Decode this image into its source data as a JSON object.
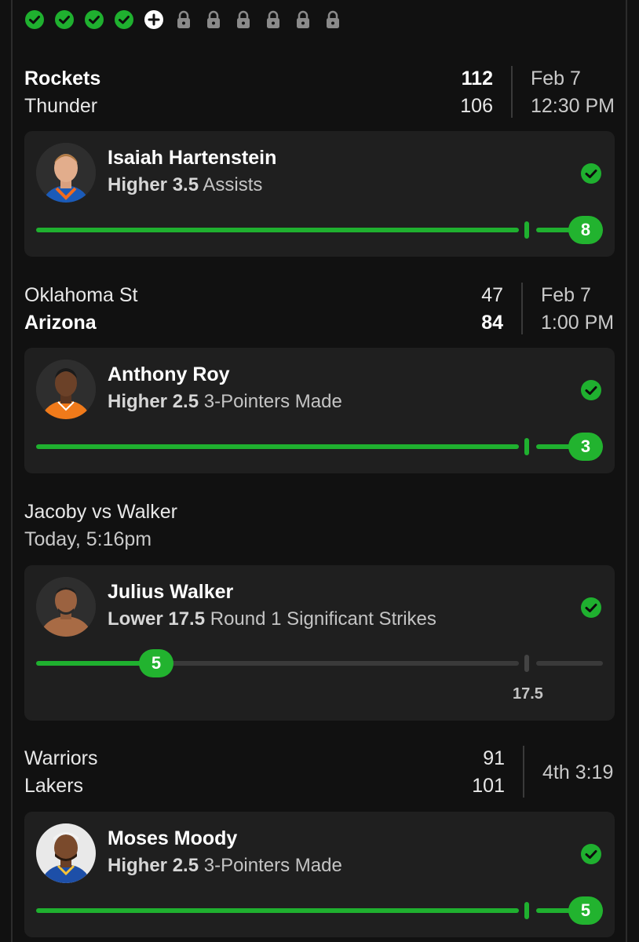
{
  "progress": {
    "pips": [
      "check-icon",
      "check-icon",
      "check-icon",
      "check-icon",
      "plus-icon",
      "lock-icon",
      "lock-icon",
      "lock-icon",
      "lock-icon",
      "lock-icon",
      "lock-icon"
    ]
  },
  "colors": {
    "accent": "#1fb02f",
    "background": "#111111",
    "card": "#1f1f1f",
    "track": "#3a3a3a"
  },
  "games": [
    {
      "teams": [
        {
          "name": "Rockets",
          "score": "112",
          "winner": true
        },
        {
          "name": "Thunder",
          "score": "106",
          "winner": false
        }
      ],
      "date": "Feb 7",
      "time": "12:30 PM",
      "pick": {
        "player": "Isaiah Hartenstein",
        "direction": "Higher",
        "line": "3.5",
        "stat": "Assists",
        "result": "8",
        "result_fraction": 1.0,
        "status_icon": "check-circle-icon"
      }
    },
    {
      "teams": [
        {
          "name": "Oklahoma St",
          "score": "47",
          "winner": false
        },
        {
          "name": "Arizona",
          "score": "84",
          "winner": true
        }
      ],
      "date": "Feb 7",
      "time": "1:00 PM",
      "pick": {
        "player": "Anthony Roy",
        "direction": "Higher",
        "line": "2.5",
        "stat": "3-Pointers Made",
        "result": "3",
        "result_fraction": 1.0,
        "status_icon": "check-circle-icon"
      }
    },
    {
      "title": "Jacoby vs Walker",
      "subtitle": "Today, 5:16pm",
      "pick": {
        "player": "Julius Walker",
        "direction": "Lower",
        "line": "17.5",
        "stat": "Round 1 Significant Strikes",
        "result": "5",
        "result_fraction": 0.25,
        "line_label": "17.5",
        "status_icon": "check-circle-icon"
      }
    },
    {
      "teams": [
        {
          "name": "Warriors",
          "score": "91",
          "winner": false
        },
        {
          "name": "Lakers",
          "score": "101",
          "winner": false
        }
      ],
      "clock": "4th 3:19",
      "pick": {
        "player": "Moses Moody",
        "direction": "Higher",
        "line": "2.5",
        "stat": "3-Pointers Made",
        "result": "5",
        "result_fraction": 1.0,
        "status_icon": "check-circle-icon"
      }
    }
  ]
}
